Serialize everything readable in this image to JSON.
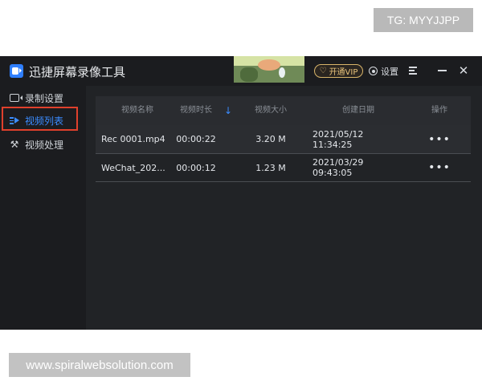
{
  "watermarks": {
    "top": "TG: MYYJJPP",
    "bottom": "www.spiralwebsolution.com"
  },
  "app": {
    "title": "迅捷屏幕录像工具",
    "vip_label": "开通VIP",
    "settings_label": "设置"
  },
  "sidebar": {
    "items": [
      {
        "label": "录制设置",
        "icon": "camera-icon"
      },
      {
        "label": "视频列表",
        "icon": "video-list-icon"
      },
      {
        "label": "视频处理",
        "icon": "tools-icon"
      }
    ],
    "active": "视频列表"
  },
  "table": {
    "columns": [
      "视频名称",
      "视频时长",
      "视频大小",
      "创建日期",
      "操作"
    ],
    "sort_icon": "↓",
    "rows": [
      {
        "name": "Rec 0001.mp4",
        "duration": "00:00:22",
        "size": "3.20 M",
        "date": "2021/05/12 11:34:25",
        "action": "•••"
      },
      {
        "name": "WeChat_202...",
        "duration": "00:00:12",
        "size": "1.23 M",
        "date": "2021/03/29 09:43:05",
        "action": "•••"
      }
    ]
  },
  "colors": {
    "accent": "#3b8cff",
    "highlight": "#e0402c",
    "vip": "#e8c27a"
  }
}
